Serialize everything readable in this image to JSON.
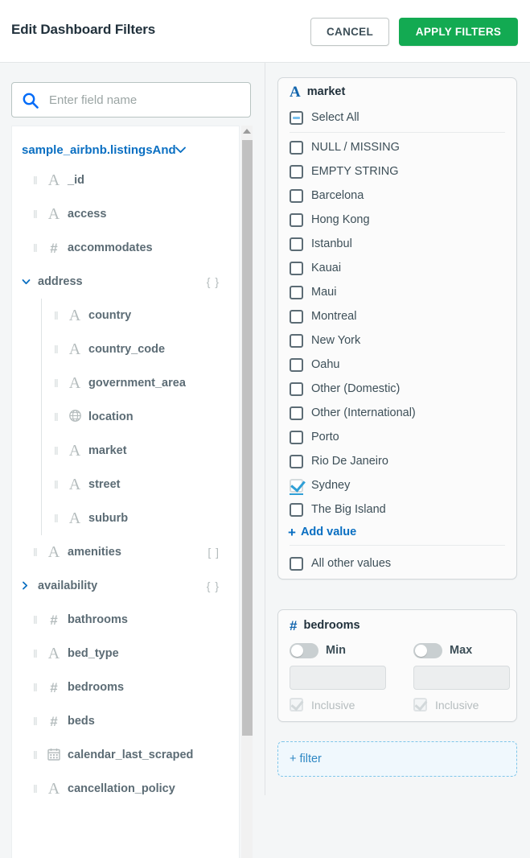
{
  "header": {
    "title": "Edit Dashboard Filters",
    "cancel_label": "CANCEL",
    "apply_label": "APPLY FILTERS",
    "apply_color": "#13aa52"
  },
  "search": {
    "icon": "search-icon",
    "placeholder": "Enter field name",
    "value": ""
  },
  "field_tree": {
    "collection": "sample_airbnb.listingsAnd",
    "collection_chevron": "chevron-down-icon",
    "fields": [
      {
        "label": "_id",
        "type": "string",
        "icon": "string-type-icon",
        "level": 0,
        "handle": true
      },
      {
        "label": "access",
        "type": "string",
        "icon": "string-type-icon",
        "level": 0,
        "handle": true
      },
      {
        "label": "accommodates",
        "type": "number",
        "icon": "number-type-icon",
        "level": 0,
        "handle": true
      },
      {
        "label": "address",
        "type": "object",
        "icon": "chevron-down-icon",
        "level": 0,
        "handle": false,
        "expanded": true,
        "badge": "{ }"
      },
      {
        "label": "country",
        "type": "string",
        "icon": "string-type-icon",
        "level": 1,
        "handle": true
      },
      {
        "label": "country_code",
        "type": "string",
        "icon": "string-type-icon",
        "level": 1,
        "handle": true
      },
      {
        "label": "government_area",
        "type": "string",
        "icon": "string-type-icon",
        "level": 1,
        "handle": true
      },
      {
        "label": "location",
        "type": "geo",
        "icon": "globe-type-icon",
        "level": 1,
        "handle": true
      },
      {
        "label": "market",
        "type": "string",
        "icon": "string-type-icon",
        "level": 1,
        "handle": true
      },
      {
        "label": "street",
        "type": "string",
        "icon": "string-type-icon",
        "level": 1,
        "handle": true
      },
      {
        "label": "suburb",
        "type": "string",
        "icon": "string-type-icon",
        "level": 1,
        "handle": true
      },
      {
        "label": "amenities",
        "type": "array",
        "icon": "string-type-icon",
        "level": 0,
        "handle": true,
        "badge": "[ ]"
      },
      {
        "label": "availability",
        "type": "object",
        "icon": "chevron-right-icon",
        "level": 0,
        "handle": false,
        "expanded": false,
        "badge": "{ }"
      },
      {
        "label": "bathrooms",
        "type": "number",
        "icon": "number-type-icon",
        "level": 0,
        "handle": true
      },
      {
        "label": "bed_type",
        "type": "string",
        "icon": "string-type-icon",
        "level": 0,
        "handle": true
      },
      {
        "label": "bedrooms",
        "type": "number",
        "icon": "number-type-icon",
        "level": 0,
        "handle": true
      },
      {
        "label": "beds",
        "type": "number",
        "icon": "number-type-icon",
        "level": 0,
        "handle": true
      },
      {
        "label": "calendar_last_scraped",
        "type": "date",
        "icon": "calendar-type-icon",
        "level": 0,
        "handle": true
      },
      {
        "label": "cancellation_policy",
        "type": "string",
        "icon": "string-type-icon",
        "level": 0,
        "handle": true
      }
    ]
  },
  "filters": {
    "market": {
      "title": "market",
      "type": "string",
      "icon": "string-type-icon",
      "select_all_label": "Select All",
      "select_all_state": "indeterminate",
      "values": [
        {
          "label": "NULL / MISSING",
          "checked": false
        },
        {
          "label": "EMPTY STRING",
          "checked": false
        },
        {
          "label": "Barcelona",
          "checked": false
        },
        {
          "label": "Hong Kong",
          "checked": false
        },
        {
          "label": "Istanbul",
          "checked": false
        },
        {
          "label": "Kauai",
          "checked": false
        },
        {
          "label": "Maui",
          "checked": false
        },
        {
          "label": "Montreal",
          "checked": false
        },
        {
          "label": "New York",
          "checked": false
        },
        {
          "label": "Oahu",
          "checked": false
        },
        {
          "label": "Other (Domestic)",
          "checked": false
        },
        {
          "label": "Other (International)",
          "checked": false
        },
        {
          "label": "Porto",
          "checked": false
        },
        {
          "label": "Rio De Janeiro",
          "checked": false
        },
        {
          "label": "Sydney",
          "checked": true
        },
        {
          "label": "The Big Island",
          "checked": false
        }
      ],
      "add_value_label": "Add value",
      "add_value_icon": "plus-icon",
      "all_other_label": "All other values",
      "all_other_checked": false
    },
    "bedrooms": {
      "title": "bedrooms",
      "type": "number",
      "icon": "number-type-icon",
      "min": {
        "toggle_label": "Min",
        "toggle_on": false,
        "value": "",
        "inclusive_label": "Inclusive",
        "inclusive_checked": true,
        "disabled": true
      },
      "max": {
        "toggle_label": "Max",
        "toggle_on": false,
        "value": "",
        "inclusive_label": "Inclusive",
        "inclusive_checked": true,
        "disabled": true
      }
    },
    "add_filter_label": "+ filter"
  }
}
